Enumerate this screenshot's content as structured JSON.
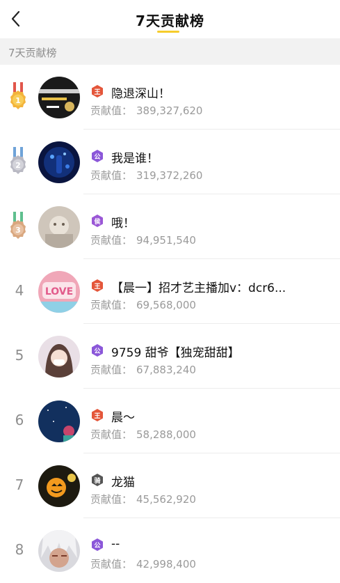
{
  "header": {
    "title": "7天贡献榜"
  },
  "section": {
    "label": "7天贡献榜"
  },
  "contribution_label": "贡献值：",
  "rows": [
    {
      "rank": "1",
      "name": "隐退深山！",
      "value": "389,327,620",
      "badge": "王",
      "badge_color": "#e4563a"
    },
    {
      "rank": "2",
      "name": "我是谁！",
      "value": "319,372,260",
      "badge": "公",
      "badge_color": "#8b57d9"
    },
    {
      "rank": "3",
      "name": "哦！",
      "value": "94,951,540",
      "badge": "侯",
      "badge_color": "#9a57d6"
    },
    {
      "rank": "4",
      "name": "【晨一】招才艺主播加v：dcr6...",
      "value": "69,568,000",
      "badge": "王",
      "badge_color": "#e4563a"
    },
    {
      "rank": "5",
      "name": "9759 甜爷【独宠甜甜】",
      "value": "67,883,240",
      "badge": "公",
      "badge_color": "#8b57d9"
    },
    {
      "rank": "6",
      "name": "晨～",
      "value": "58,288,000",
      "badge": "王",
      "badge_color": "#e4563a"
    },
    {
      "rank": "7",
      "name": "龙猫",
      "value": "45,562,920",
      "badge": "骑",
      "badge_color": "#555555"
    },
    {
      "rank": "8",
      "name": "--",
      "value": "42,998,400",
      "badge": "公",
      "badge_color": "#8b57d9"
    }
  ],
  "colors": {
    "accent_yellow": "#f6cc2c",
    "medal_gold": "#f3b43c",
    "medal_silver": "#b9b9c3",
    "medal_bronze": "#d9a77f"
  }
}
